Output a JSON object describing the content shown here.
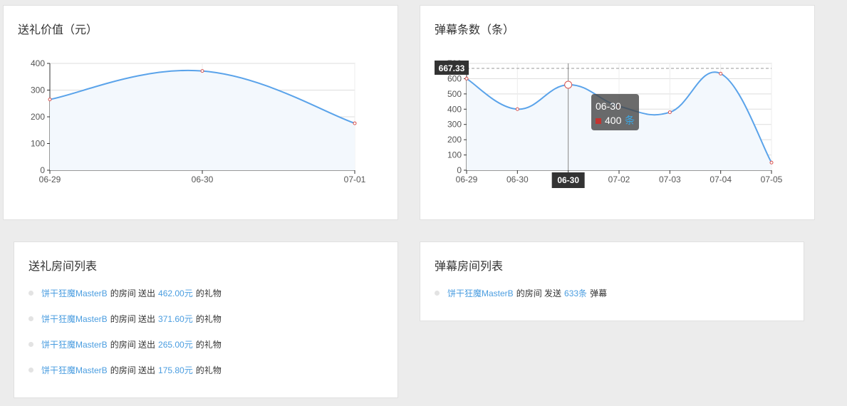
{
  "gift_chart": {
    "title": "送礼价值（元）",
    "chart_data": {
      "type": "line",
      "categories": [
        "06-29",
        "06-30",
        "07-01"
      ],
      "values": [
        265,
        371.6,
        175.8
      ],
      "ylim": [
        0,
        400
      ],
      "yticks": [
        "0",
        "100",
        "200",
        "300",
        "400"
      ],
      "line_color": "#5aa3ea",
      "area_color": "#f3f8fd",
      "point_color": "#d9534f"
    }
  },
  "danmu_chart": {
    "title": "弹幕条数（条）",
    "chart_data": {
      "type": "line",
      "categories": [
        "06-29",
        "06-30",
        "06-30",
        "07-02",
        "07-03",
        "07-04",
        "07-05"
      ],
      "values": [
        600,
        400,
        560,
        420,
        380,
        633,
        50
      ],
      "ylim": [
        0,
        700
      ],
      "yticks": [
        "0",
        "100",
        "200",
        "300",
        "400",
        "500",
        "600",
        "700"
      ],
      "line_color": "#5aa3ea",
      "area_color": "#f3f8fd",
      "point_color": "#d9534f",
      "markline_value": "667.33",
      "axis_pointer_label": "06-30",
      "tooltip": {
        "title": "06-30",
        "value": "400",
        "unit": "条",
        "unit_color": "#3aa8e6",
        "marker_color": "#c23531"
      }
    }
  },
  "gift_list": {
    "title": "送礼房间列表",
    "items": [
      {
        "room": "饼干狂魔MasterB",
        "mid": "的房间 送出",
        "amount": "462.00元",
        "tail": "的礼物"
      },
      {
        "room": "饼干狂魔MasterB",
        "mid": "的房间 送出",
        "amount": "371.60元",
        "tail": "的礼物"
      },
      {
        "room": "饼干狂魔MasterB",
        "mid": "的房间 送出",
        "amount": "265.00元",
        "tail": "的礼物"
      },
      {
        "room": "饼干狂魔MasterB",
        "mid": "的房间 送出",
        "amount": "175.80元",
        "tail": "的礼物"
      }
    ]
  },
  "danmu_list": {
    "title": "弹幕房间列表",
    "items": [
      {
        "room": "饼干狂魔MasterB",
        "mid": "的房间 发送",
        "amount": "633条",
        "tail": "弹幕"
      }
    ]
  }
}
